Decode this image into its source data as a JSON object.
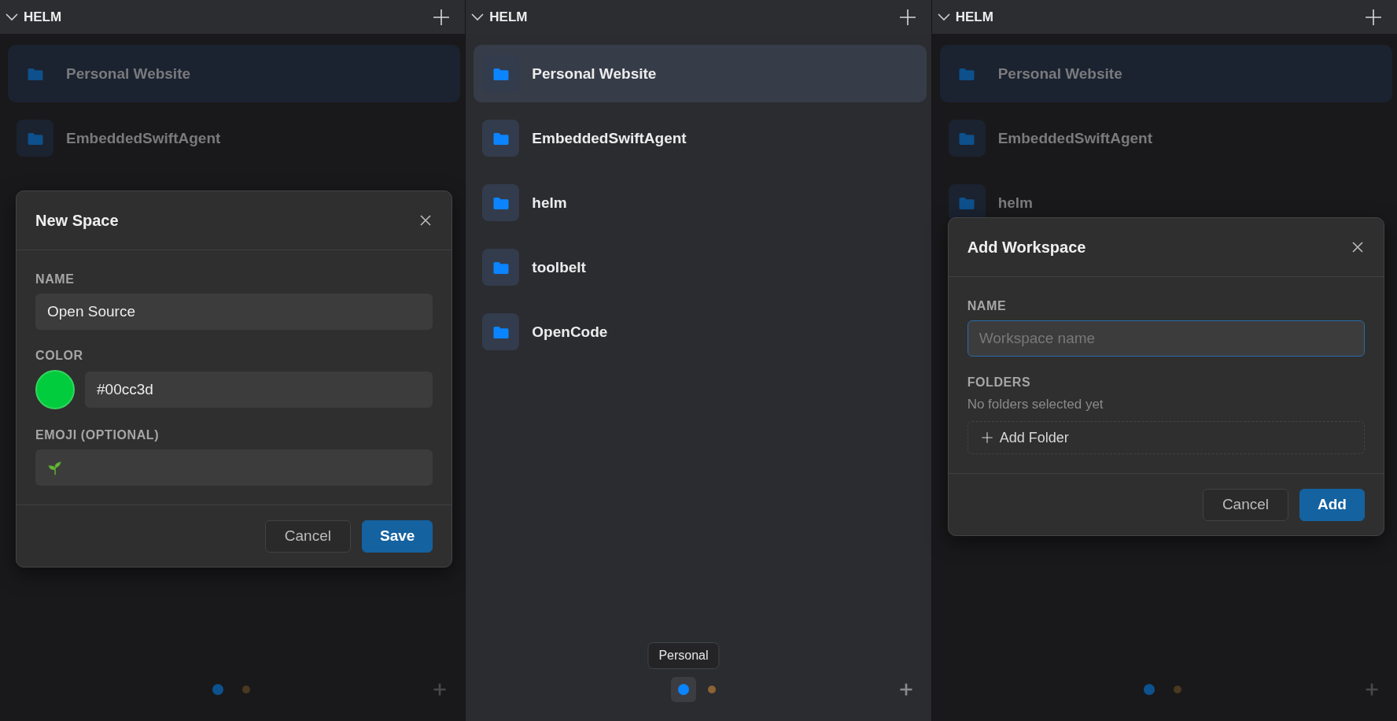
{
  "panels": [
    {
      "header": {
        "title": "HELM"
      },
      "dimmed": true,
      "items": [
        {
          "label": "Personal Website",
          "selected": true
        },
        {
          "label": "EmbeddedSwiftAgent",
          "selected": false
        }
      ],
      "footer": {
        "dots": [
          {
            "color": "#0d528f",
            "selected": true,
            "hovered": false
          },
          {
            "color": "#4a3820",
            "selected": false,
            "hovered": false
          }
        ]
      },
      "modal": {
        "title": "New Space",
        "fields": [
          {
            "kind": "text",
            "label": "NAME",
            "value": "Open Source",
            "focused": false
          },
          {
            "kind": "color",
            "label": "COLOR",
            "value": "#00cc3d",
            "color": "#00cc3d"
          },
          {
            "kind": "emoji",
            "label": "EMOJI (OPTIONAL)",
            "filled": true
          }
        ],
        "buttons": [
          {
            "label": "Cancel",
            "primary": false
          },
          {
            "label": "Save",
            "primary": true
          }
        ]
      }
    },
    {
      "header": {
        "title": "HELM"
      },
      "dimmed": false,
      "items": [
        {
          "label": "Personal Website",
          "selected": true
        },
        {
          "label": "EmbeddedSwiftAgent",
          "selected": false
        },
        {
          "label": "helm",
          "selected": false
        },
        {
          "label": "toolbelt",
          "selected": false
        },
        {
          "label": "OpenCode",
          "selected": false
        }
      ],
      "footer": {
        "dots": [
          {
            "color": "#0a84ff",
            "selected": true,
            "hovered": true,
            "tooltip": "Personal"
          },
          {
            "color": "#8b6334",
            "selected": false,
            "hovered": false
          }
        ]
      }
    },
    {
      "header": {
        "title": "HELM"
      },
      "dimmed": true,
      "items": [
        {
          "label": "Personal Website",
          "selected": true
        },
        {
          "label": "EmbeddedSwiftAgent",
          "selected": false
        },
        {
          "label": "helm",
          "selected": false
        }
      ],
      "footer": {
        "dots": [
          {
            "color": "#0d528f",
            "selected": true,
            "hovered": false
          },
          {
            "color": "#4a3820",
            "selected": false,
            "hovered": false
          }
        ]
      },
      "modal": {
        "title": "Add Workspace",
        "fields": [
          {
            "kind": "text",
            "label": "NAME",
            "placeholder": "Workspace name",
            "focused": true
          },
          {
            "kind": "folders",
            "label": "FOLDERS",
            "hint": "No folders selected yet",
            "button": "Add Folder"
          }
        ],
        "buttons": [
          {
            "label": "Cancel",
            "primary": false
          },
          {
            "label": "Add",
            "primary": true
          }
        ]
      }
    }
  ]
}
